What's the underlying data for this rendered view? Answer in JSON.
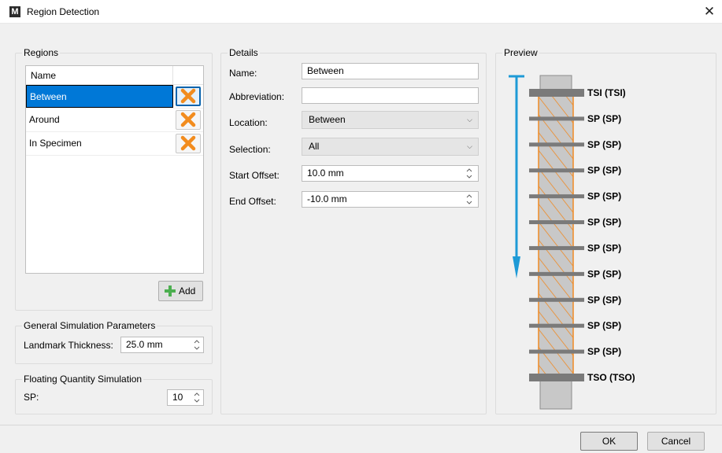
{
  "window": {
    "title": "Region Detection",
    "close_glyph": "✕"
  },
  "regions": {
    "title": "Regions",
    "column_header": "Name",
    "rows": [
      {
        "name": "Between",
        "selected": true
      },
      {
        "name": "Around",
        "selected": false
      },
      {
        "name": "In Specimen",
        "selected": false
      }
    ],
    "add_label": "Add",
    "delete_icon_color": "#f28c1e",
    "add_icon_color": "#4caf50"
  },
  "general_params": {
    "title": "General Simulation Parameters",
    "landmark_label": "Landmark Thickness:",
    "landmark_value": "25.0 mm"
  },
  "floating": {
    "title": "Floating Quantity Simulation",
    "sp_label": "SP:",
    "sp_value": "10"
  },
  "details": {
    "title": "Details",
    "name_label": "Name:",
    "name_value": "Between",
    "abbrev_label": "Abbreviation:",
    "abbrev_value": "",
    "location_label": "Location:",
    "location_value": "Between",
    "selection_label": "Selection:",
    "selection_value": "All",
    "start_label": "Start Offset:",
    "start_value": "10.0 mm",
    "end_label": "End Offset:",
    "end_value": "-10.0 mm"
  },
  "preview": {
    "title": "Preview",
    "landmarks": [
      "TSI (TSI)",
      "SP (SP)",
      "SP (SP)",
      "SP (SP)",
      "SP (SP)",
      "SP (SP)",
      "SP (SP)",
      "SP (SP)",
      "SP (SP)",
      "SP (SP)",
      "SP (SP)",
      "TSO (TSO)"
    ],
    "arrow_color": "#1e9ad6",
    "hatch_color": "#f08a24",
    "specimen_color": "#c8c8c8",
    "bar_color": "#7a7a7a"
  },
  "footer": {
    "ok_label": "OK",
    "cancel_label": "Cancel"
  }
}
